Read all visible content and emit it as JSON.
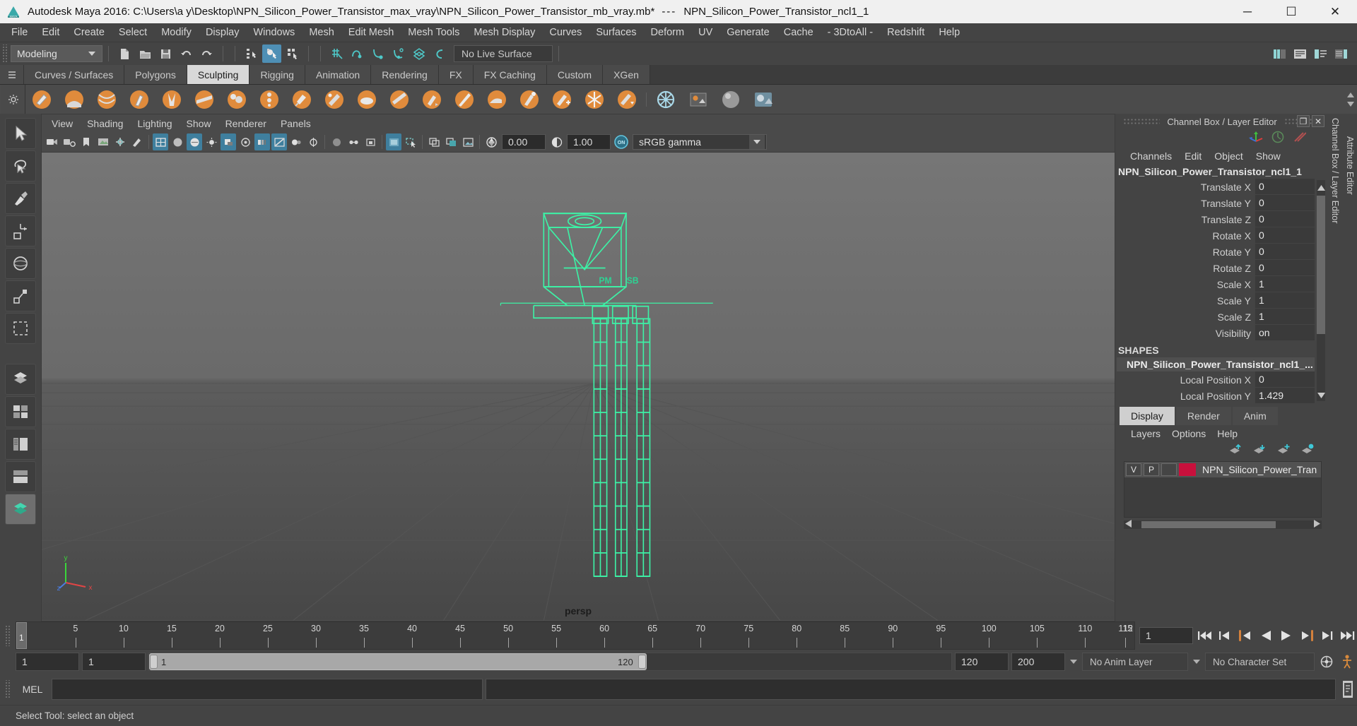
{
  "window": {
    "title": "Autodesk Maya 2016: C:\\Users\\a y\\Desktop\\NPN_Silicon_Power_Transistor_max_vray\\NPN_Silicon_Power_Transistor_mb_vray.mb*",
    "title_separator": "---",
    "title_suffix": "NPN_Silicon_Power_Transistor_ncl1_1",
    "minimize": "─",
    "maximize": "☐",
    "close": "✕"
  },
  "menubar": {
    "items": [
      "File",
      "Edit",
      "Create",
      "Select",
      "Modify",
      "Display",
      "Windows",
      "Mesh",
      "Edit Mesh",
      "Mesh Tools",
      "Mesh Display",
      "Curves",
      "Surfaces",
      "Deform",
      "UV",
      "Generate",
      "Cache",
      "- 3DtoAll -",
      "Redshift",
      "Help"
    ]
  },
  "statusbar": {
    "mode": "Modeling",
    "live_surface": "No Live Surface",
    "file_icons": [
      "new-scene-icon",
      "open-scene-icon",
      "save-scene-icon",
      "undo-icon",
      "redo-icon"
    ],
    "select_mask_icons": [
      "select-by-hierarchy-icon",
      "select-by-object-type-icon",
      "select-by-component-type-icon"
    ],
    "snap_icons": [
      "snap-to-grid-icon",
      "snap-to-curve-icon",
      "snap-to-point-icon",
      "snap-to-projected-center-icon",
      "snap-to-view-plane-icon",
      "make-live-icon"
    ],
    "right_icons": [
      "show-hide-editor-icon",
      "attribute-editor-icon",
      "tool-settings-icon",
      "channel-box-icon"
    ]
  },
  "shelf": {
    "tabs": [
      "Curves / Surfaces",
      "Polygons",
      "Sculpting",
      "Rigging",
      "Animation",
      "Rendering",
      "FX",
      "FX Caching",
      "Custom",
      "XGen"
    ],
    "active_tab": "Sculpting",
    "icons": [
      "sculpt-tool-icon",
      "smooth-tool-icon",
      "relax-tool-icon",
      "grab-tool-icon",
      "pinch-tool-icon",
      "flatten-tool-icon",
      "foamy-tool-icon",
      "spray-tool-icon",
      "repeat-tool-icon",
      "imprint-tool-icon",
      "wax-tool-icon",
      "scrape-tool-icon",
      "fill-tool-icon",
      "knife-tool-icon",
      "smear-tool-icon",
      "bulge-tool-icon",
      "amplify-tool-icon",
      "freeze-tool-icon",
      "convert-tool-icon",
      "mirror-settings-icon",
      "sculpt-settings-icon",
      "sphere-brush-icon",
      "stamp-brush-icon"
    ]
  },
  "toolbox": {
    "items": [
      {
        "name": "select-tool",
        "active": false
      },
      {
        "name": "lasso-select-tool",
        "active": false
      },
      {
        "name": "paint-selection-tool",
        "active": false
      },
      {
        "name": "move-tool",
        "active": false
      },
      {
        "name": "rotate-tool",
        "active": false
      },
      {
        "name": "scale-tool",
        "active": false
      },
      {
        "name": "last-tool-used",
        "active": false
      },
      {
        "name": "quick-layout-single-perspective",
        "active": false
      },
      {
        "name": "quick-layout-four-view",
        "active": false
      },
      {
        "name": "quick-layout-outliner-persp",
        "active": false
      },
      {
        "name": "quick-layout-hypergraph",
        "active": false
      },
      {
        "name": "quick-layout-persp-graph",
        "active": true
      }
    ]
  },
  "viewport": {
    "menus": [
      "View",
      "Shading",
      "Lighting",
      "Show",
      "Renderer",
      "Panels"
    ],
    "camera_label": "persp",
    "exposure_value": "0.00",
    "gamma_value": "1.00",
    "color_management": "sRGB gamma",
    "color_management_toggle": "ON",
    "axis_labels": {
      "x": "x",
      "y": "y",
      "z": "z"
    },
    "object_labels": [
      "PM",
      "SB"
    ],
    "toolbar_icons": [
      "select-camera-icon",
      "camera-attributes-icon",
      "bookmark-icon",
      "image-plane-icon",
      "two-d-pan-zoom-icon",
      "grease-pencil-icon",
      "wireframe-icon",
      "smooth-shade-all-icon",
      "shaded-textured-icon",
      "use-all-lights-icon",
      "shadows-icon",
      "screen-space-ao-icon",
      "motion-blur-icon",
      "multisample-aa-icon",
      "depth-of-field-icon",
      "isolate-select-icon",
      "xray-icon",
      "xray-joints-icon",
      "xray-active-components-icon",
      "viewport-renderer-icon",
      "region-select-icon",
      "panel-copy-icon",
      "panel-tear-off-icon",
      "snapshot-icon",
      "exposure-icon",
      "gamma-icon",
      "color-management-icon"
    ]
  },
  "channel_box": {
    "panel_title": "Channel Box / Layer Editor",
    "restore_icon": "❐",
    "close_icon": "✕",
    "toolbar_icons": [
      "manipulator-axis-icon",
      "speed-icon",
      "slash-icon"
    ],
    "menus": [
      "Channels",
      "Edit",
      "Object",
      "Show"
    ],
    "object_name": "NPN_Silicon_Power_Transistor_ncl1_1",
    "channels": [
      {
        "attr": "Translate X",
        "value": "0"
      },
      {
        "attr": "Translate Y",
        "value": "0"
      },
      {
        "attr": "Translate Z",
        "value": "0"
      },
      {
        "attr": "Rotate X",
        "value": "0"
      },
      {
        "attr": "Rotate Y",
        "value": "0"
      },
      {
        "attr": "Rotate Z",
        "value": "0"
      },
      {
        "attr": "Scale X",
        "value": "1"
      },
      {
        "attr": "Scale Y",
        "value": "1"
      },
      {
        "attr": "Scale Z",
        "value": "1"
      },
      {
        "attr": "Visibility",
        "value": "on"
      }
    ],
    "shapes_header": "SHAPES",
    "shape_name": "NPN_Silicon_Power_Transistor_ncl1_...",
    "shape_channels": [
      {
        "attr": "Local Position X",
        "value": "0"
      },
      {
        "attr": "Local Position Y",
        "value": "1.429"
      }
    ]
  },
  "layer_editor": {
    "tabs": [
      "Display",
      "Render",
      "Anim"
    ],
    "active_tab": "Display",
    "menus": [
      "Layers",
      "Options",
      "Help"
    ],
    "tool_icons": [
      "move-layer-up-icon",
      "move-layer-down-icon",
      "new-layer-icon",
      "new-layer-from-selected-icon"
    ],
    "layers": [
      {
        "visibility": "V",
        "playback": "P",
        "shading": "",
        "color": "#c8103c",
        "name": "NPN_Silicon_Power_Tran"
      }
    ]
  },
  "right_strip": {
    "labels": [
      "Channel Box / Layer Editor",
      "Attribute Editor"
    ]
  },
  "timeline": {
    "current_frame": "1",
    "frame_field": "1",
    "start_label": "1",
    "ticks": [
      5,
      10,
      15,
      20,
      25,
      30,
      35,
      40,
      45,
      50,
      55,
      60,
      65,
      70,
      75,
      80,
      85,
      90,
      95,
      100,
      105,
      110,
      115
    ],
    "end_tick": "12",
    "playback_icons": [
      "go-to-start-icon",
      "step-back-frame-icon",
      "step-back-key-icon",
      "play-backwards-icon",
      "play-forwards-icon",
      "step-forward-key-icon",
      "step-forward-frame-icon",
      "go-to-end-icon"
    ]
  },
  "rangeslider": {
    "anim_start": "1",
    "range_start": "1",
    "slider_start_label": "1",
    "slider_end_label": "120",
    "range_end": "120",
    "anim_end": "200",
    "anim_layer": "No Anim Layer",
    "character_set": "No Character Set",
    "auto_key_icon": "auto-keyframe-icon",
    "anim_prefs_icon": "animation-preferences-icon"
  },
  "commandline": {
    "language": "MEL",
    "input_value": "",
    "output_value": "",
    "script_editor_icon": "script-editor-icon"
  },
  "helpline": {
    "text": "Select Tool: select an object"
  },
  "colors": {
    "accent_blue": "#4e8fb5",
    "shelf_orange": "#e08b3c",
    "selection_green": "#44f0a0",
    "layer_red": "#c8103c",
    "viewport_bg_top": "#6e6e6e",
    "viewport_bg_bottom": "#4b4b4b"
  }
}
